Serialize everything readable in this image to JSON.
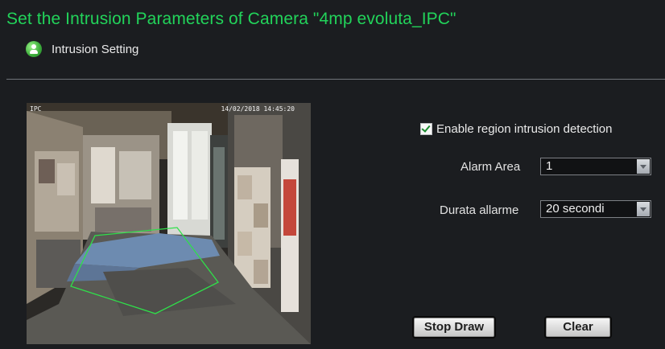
{
  "header": {
    "title": "Set the Intrusion Parameters of Camera \"4mp evoluta_IPC\""
  },
  "section": {
    "label": "Intrusion Setting",
    "icon": "user-bubble-icon"
  },
  "video": {
    "osd_name": "IPC",
    "osd_time": "14/02/2018 14:45:20",
    "region_color": "#2fe04a"
  },
  "form": {
    "enable": {
      "label": "Enable region intrusion detection",
      "checked": true
    },
    "alarm_area": {
      "label": "Alarm Area",
      "value": "1"
    },
    "duration": {
      "label": "Durata allarme",
      "value": "20 secondi"
    }
  },
  "buttons": {
    "stop_draw": "Stop Draw",
    "clear": "Clear"
  },
  "colors": {
    "title": "#22d35a",
    "background": "#1b1d20",
    "accent_check": "#1b8b2f"
  }
}
